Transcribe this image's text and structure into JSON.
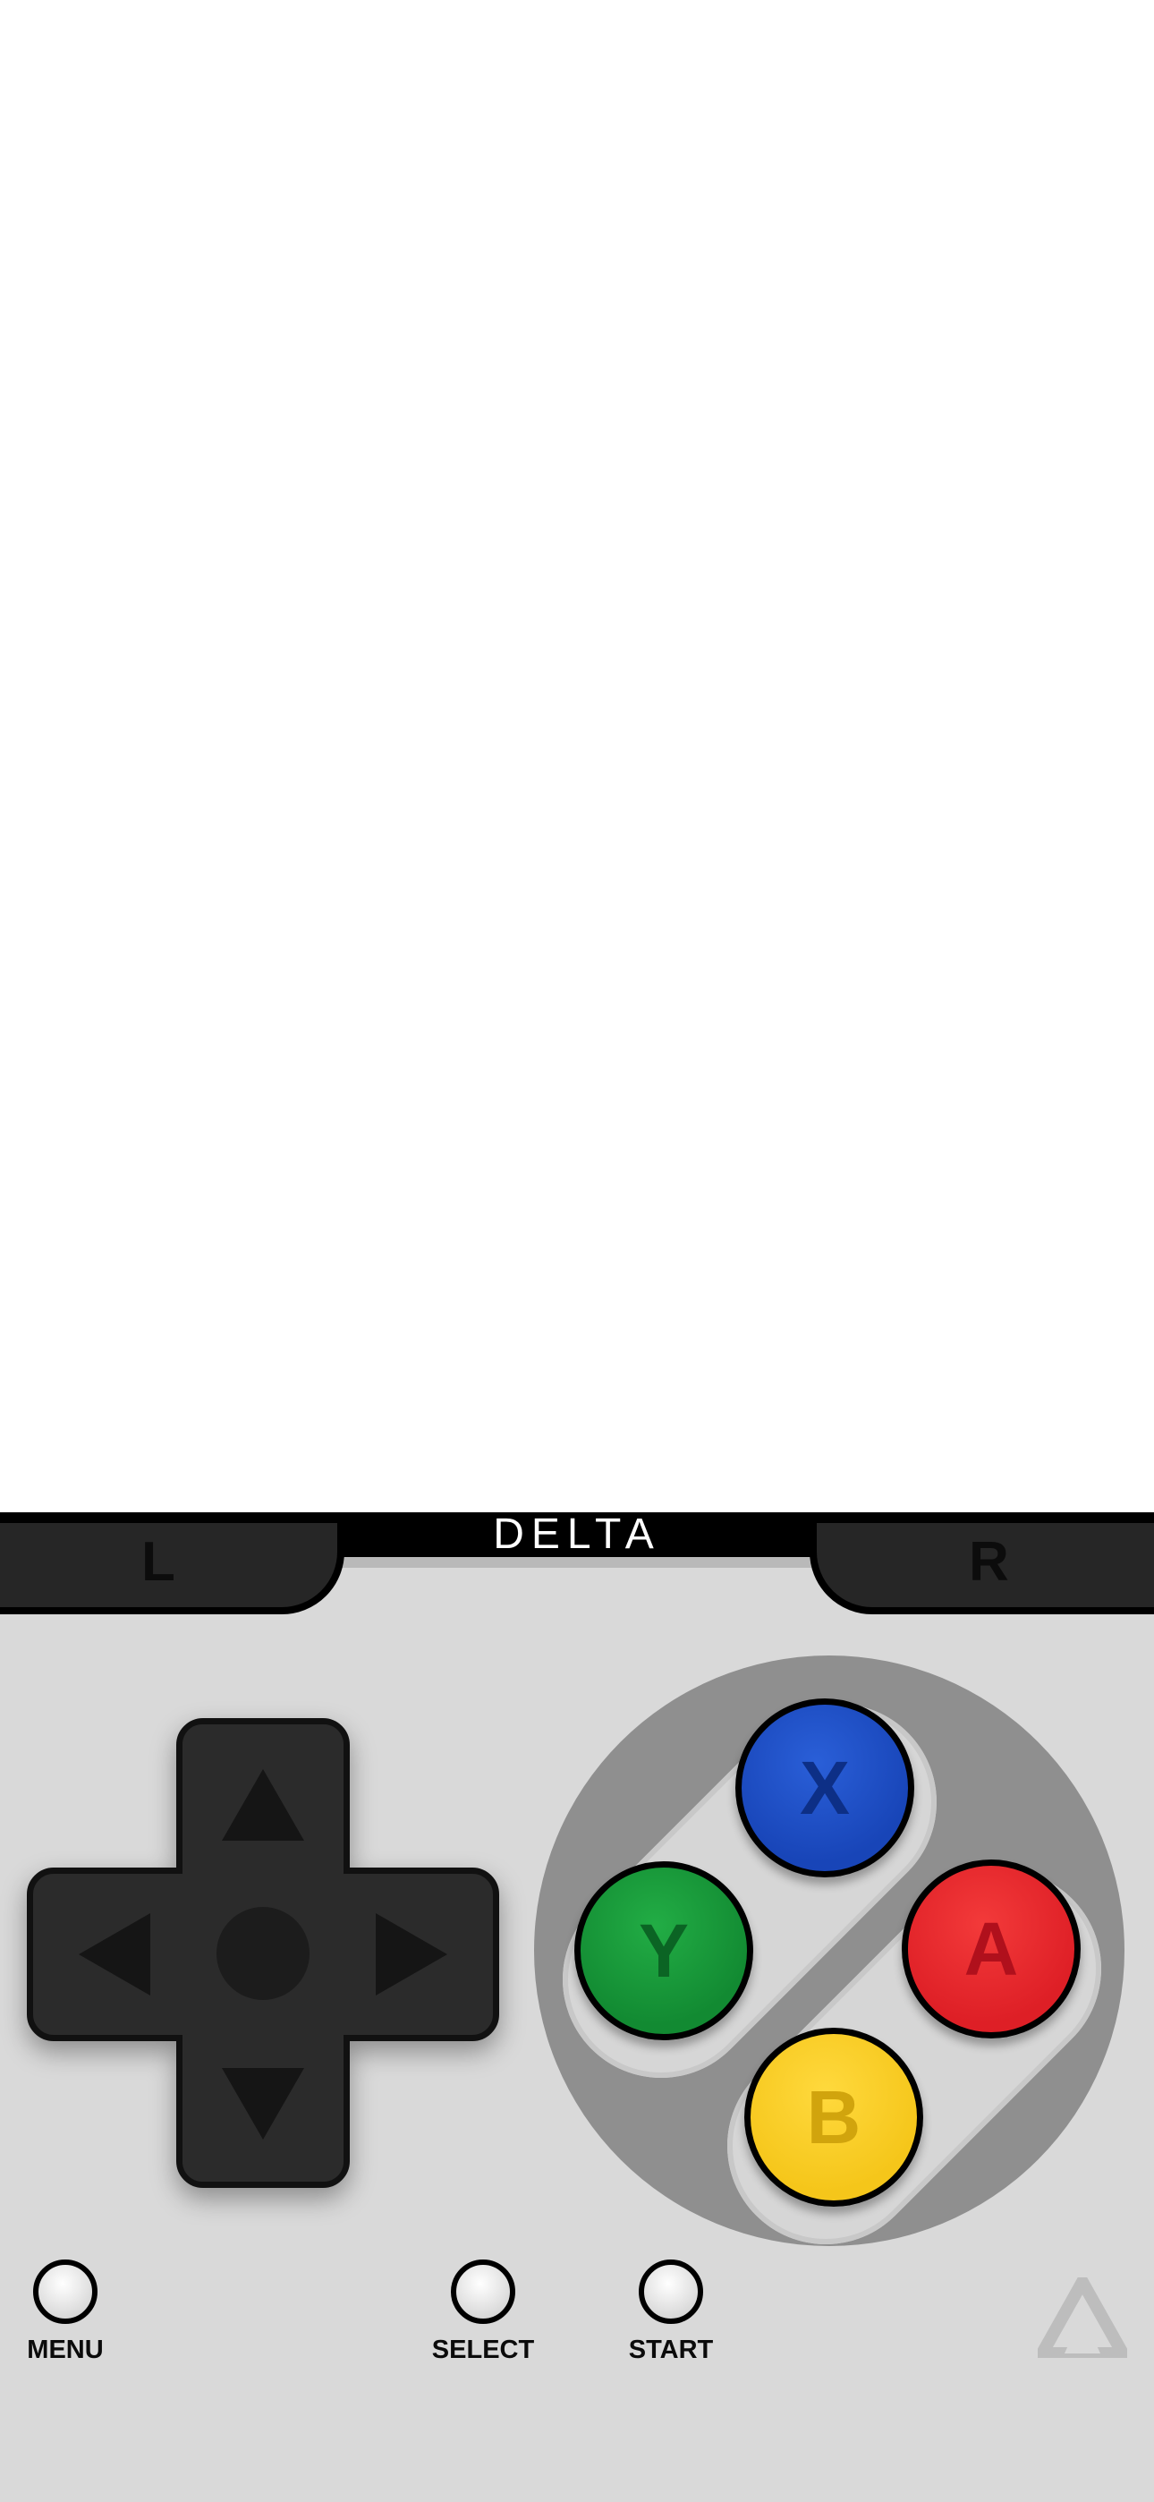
{
  "brand": {
    "logo_text": "DELTA"
  },
  "colors": {
    "background": "#d9d9d9",
    "dpad": "#2b2b2b",
    "x_button": "#1845b8",
    "y_button": "#128a32",
    "a_button": "#de1f26",
    "b_button": "#f5c61a",
    "face_area": "#8f8f8f"
  },
  "shoulder_buttons": {
    "left_label": "L",
    "right_label": "R"
  },
  "face_buttons": {
    "x": "X",
    "y": "Y",
    "a": "A",
    "b": "B"
  },
  "system_buttons": {
    "menu": "MENU",
    "select": "SELECT",
    "start": "START"
  },
  "icons": [
    "dpad-up-icon",
    "dpad-down-icon",
    "dpad-left-icon",
    "dpad-right-icon",
    "delta-logo-icon"
  ]
}
